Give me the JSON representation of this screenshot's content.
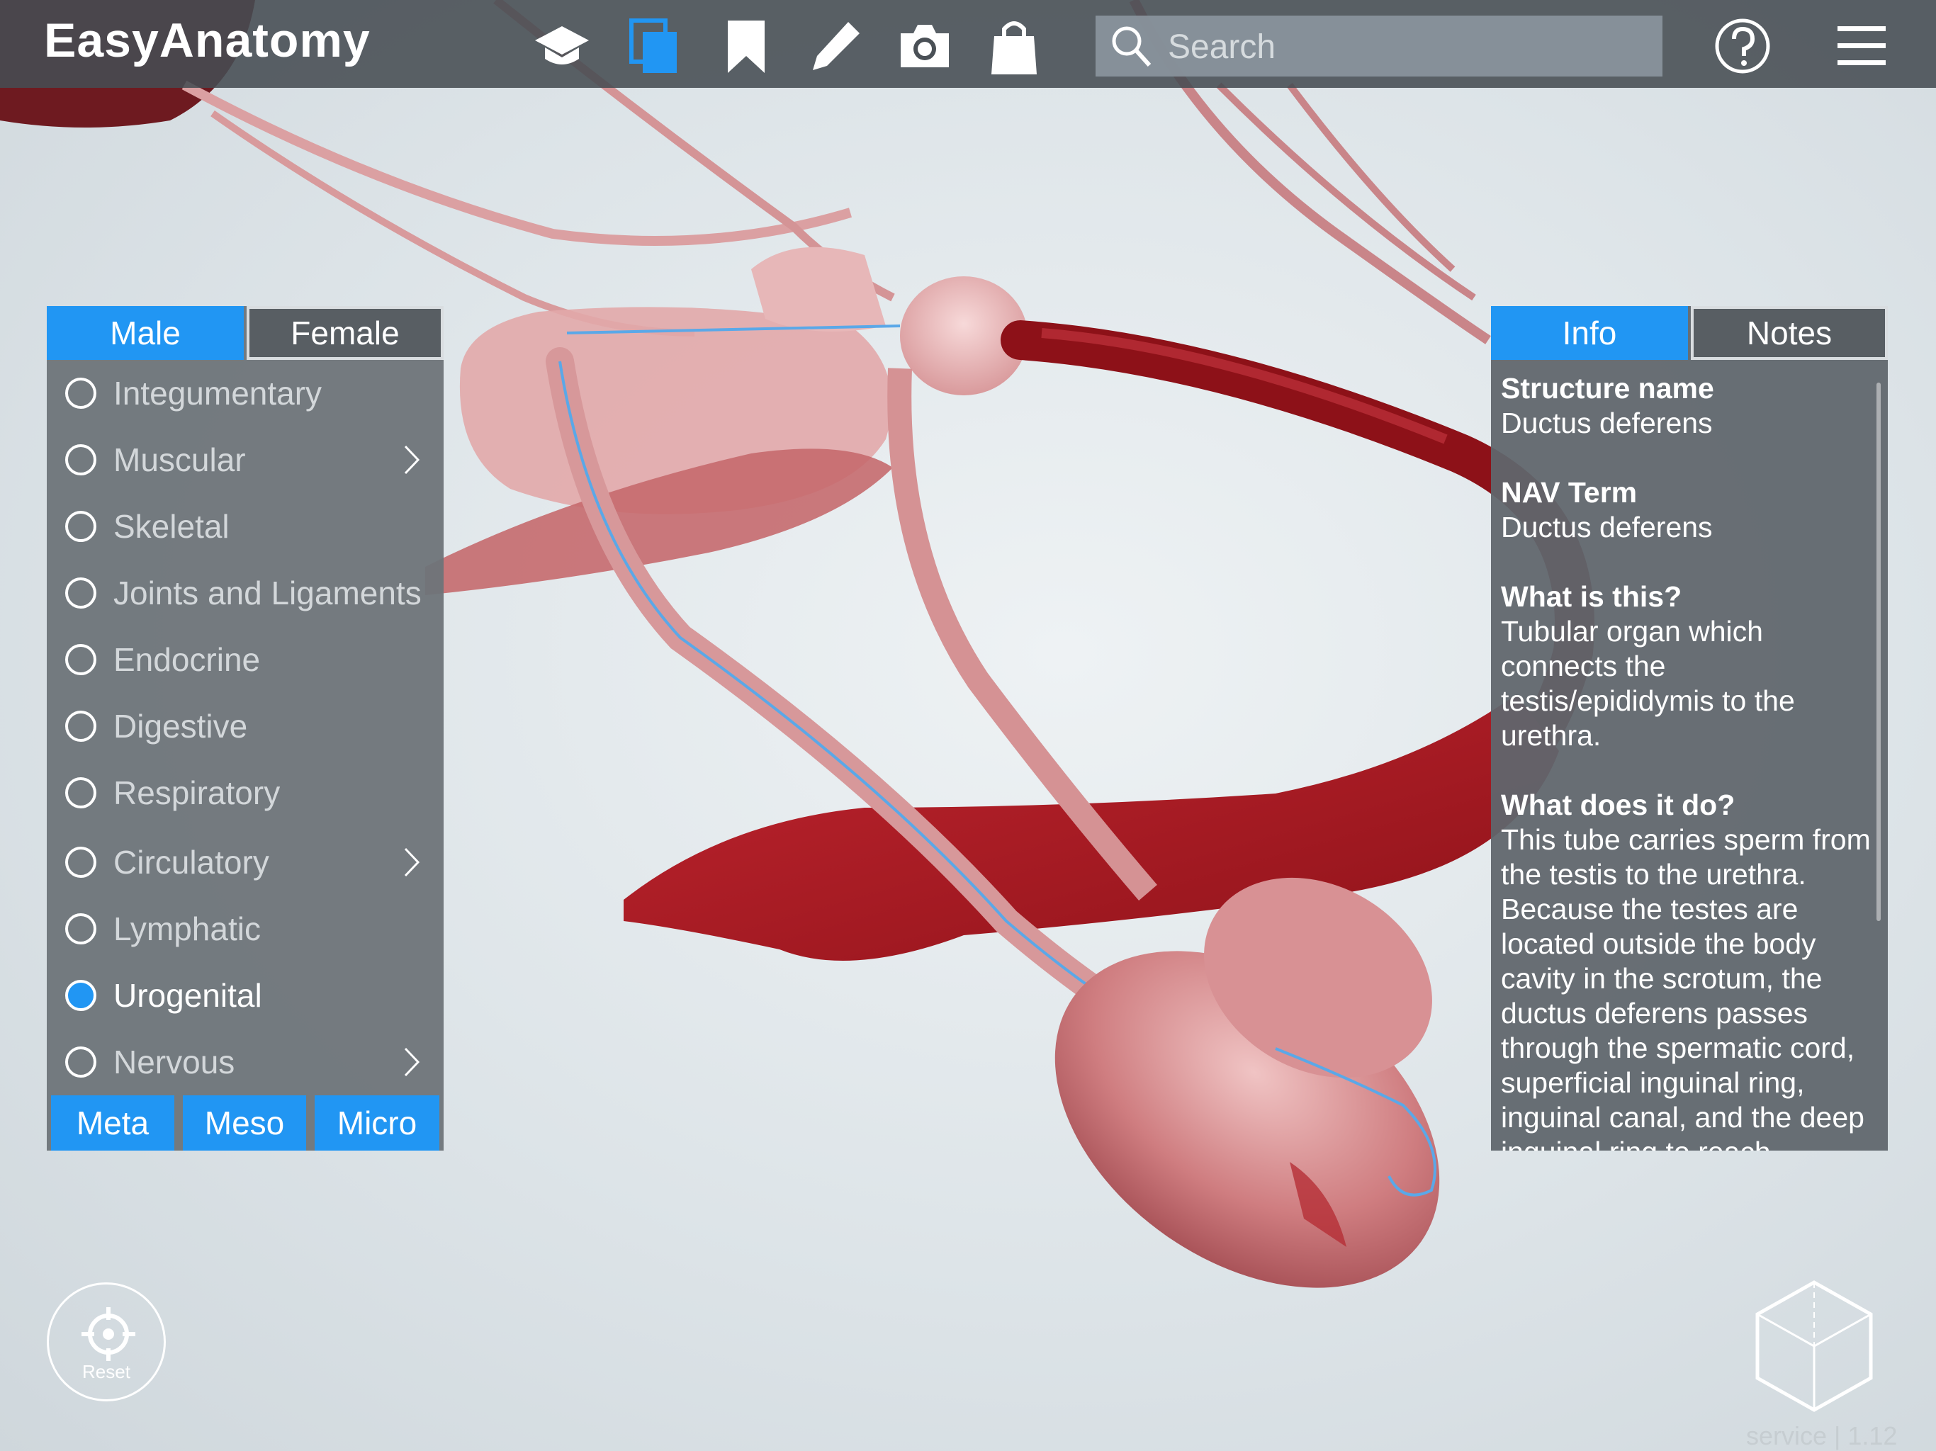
{
  "app": {
    "title": "EasyAnatomy"
  },
  "toolbar": {
    "icons": [
      "graduation-cap-icon",
      "copy-layers-icon",
      "bookmark-icon",
      "pencil-icon",
      "camera-icon",
      "shopping-bag-icon",
      "help-icon",
      "menu-icon"
    ],
    "search_placeholder": "Search"
  },
  "left_panel": {
    "tabs": {
      "male": "Male",
      "female": "Female",
      "active": "Male"
    },
    "systems": [
      {
        "label": "Integumentary",
        "selected": false,
        "submenu": false
      },
      {
        "label": "Muscular",
        "selected": false,
        "submenu": true
      },
      {
        "label": "Skeletal",
        "selected": false,
        "submenu": false
      },
      {
        "label": "Joints and Ligaments",
        "selected": false,
        "submenu": false
      },
      {
        "label": "Endocrine",
        "selected": false,
        "submenu": false
      },
      {
        "label": "Digestive",
        "selected": false,
        "submenu": false
      },
      {
        "label": "Respiratory",
        "selected": false,
        "submenu": false
      },
      {
        "label": "Circulatory",
        "selected": false,
        "submenu": true
      },
      {
        "label": "Lymphatic",
        "selected": false,
        "submenu": false
      },
      {
        "label": "Urogenital",
        "selected": true,
        "submenu": false
      },
      {
        "label": "Nervous",
        "selected": false,
        "submenu": true
      }
    ],
    "levels": [
      "Meta",
      "Meso",
      "Micro"
    ]
  },
  "right_panel": {
    "tabs": {
      "info": "Info",
      "notes": "Notes",
      "active": "Info"
    },
    "info": [
      {
        "heading": "Structure name",
        "text": "Ductus deferens"
      },
      {
        "heading": "NAV Term",
        "text": "Ductus deferens"
      },
      {
        "heading": "What is this?",
        "text": "Tubular organ which connects the testis/epididymis to the urethra."
      },
      {
        "heading": "What does it do?",
        "text": "This tube carries sperm from the testis to the urethra. Because the testes are located outside the body cavity in the scrotum, the ductus deferens passes through the spermatic cord, superficial inguinal ring, inguinal canal, and the deep inguinal ring to reach"
      }
    ]
  },
  "controls": {
    "reset_label": "Reset",
    "version": "service | 1.12"
  },
  "colors": {
    "accent": "#2196f3",
    "muscle": "#b0202a",
    "vessel": "#e3a4a4"
  }
}
